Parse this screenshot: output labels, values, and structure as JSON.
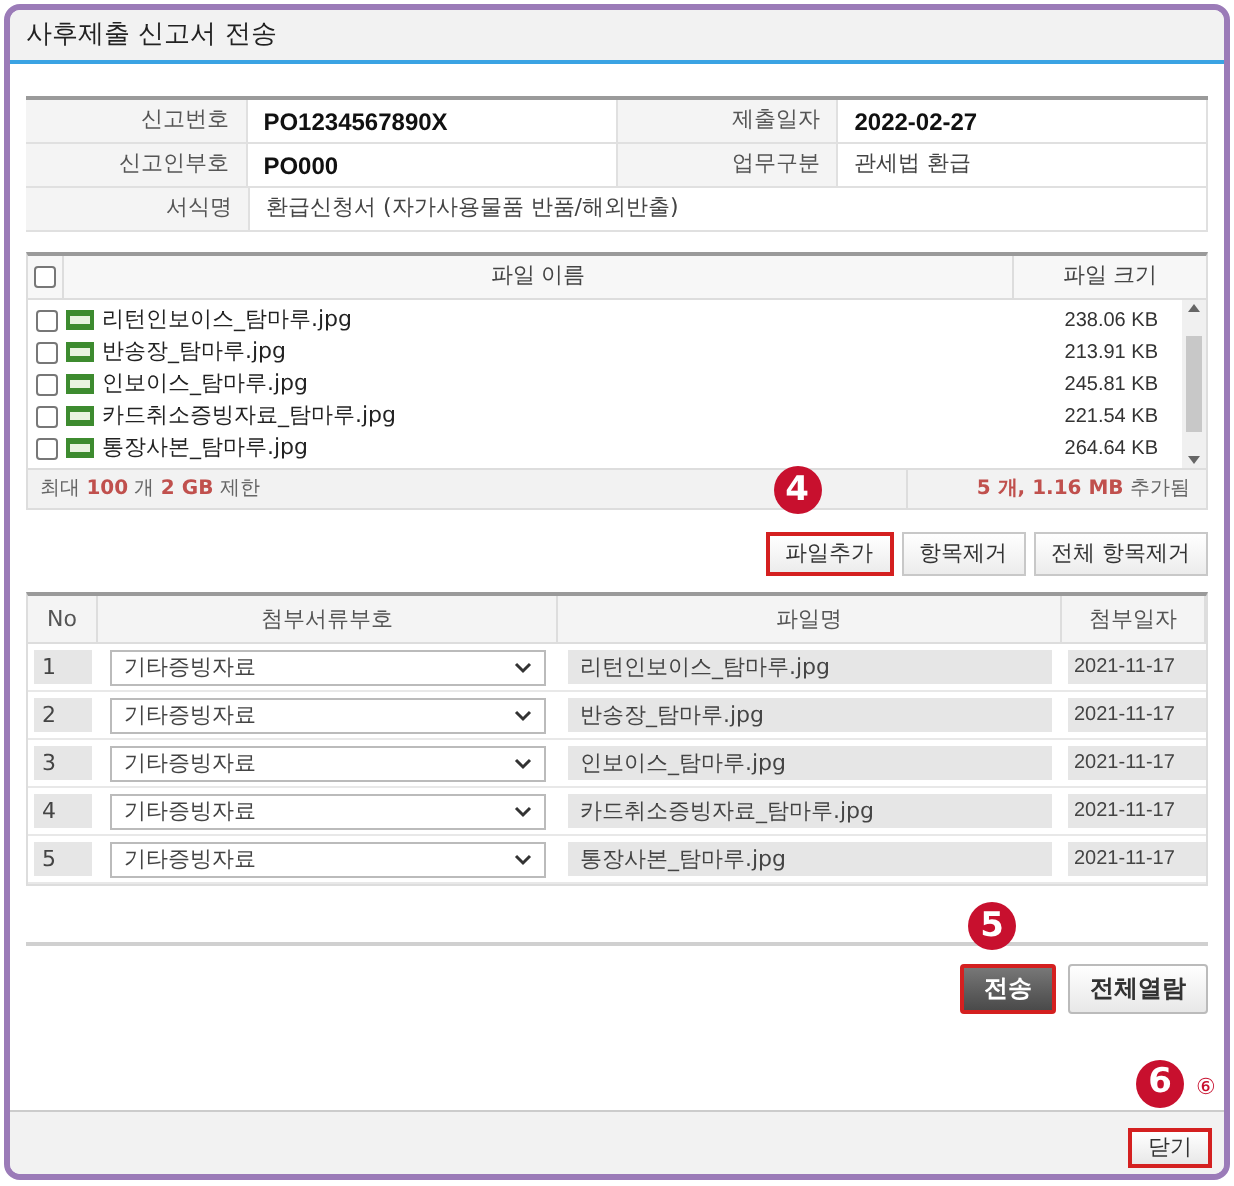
{
  "window": {
    "title": "사후제출 신고서 전송"
  },
  "info_rows": [
    [
      {
        "label": "신고번호",
        "value": "PO1234567890X",
        "kind": "code"
      },
      {
        "label": "제출일자",
        "value": "2022-02-27",
        "kind": "code"
      }
    ],
    [
      {
        "label": "신고인부호",
        "value": "PO000",
        "kind": "code"
      },
      {
        "label": "업무구분",
        "value": "관세법 환급",
        "kind": "text"
      }
    ],
    [
      {
        "label": "서식명",
        "value": "환급신청서 (자가사용물품 반품/해외반출)",
        "kind": "text"
      }
    ]
  ],
  "file_list": {
    "select_all_checked": false,
    "columns": [
      "파일 이름",
      "파일 크기"
    ],
    "files": [
      {
        "name": "리턴인보이스_탐마루.jpg",
        "size": "238.06 KB",
        "checked": false
      },
      {
        "name": "반송장_탐마루.jpg",
        "size": "213.91 KB",
        "checked": false
      },
      {
        "name": "인보이스_탐마루.jpg",
        "size": "245.81 KB",
        "checked": false
      },
      {
        "name": "카드취소증빙자료_탐마루.jpg",
        "size": "221.54 KB",
        "checked": false
      },
      {
        "name": "통장사본_탐마루.jpg",
        "size": "264.64 KB",
        "checked": false
      }
    ],
    "limit": "최대 **100** 개 **2 GB** 제한",
    "summary": "**5 개, 1.16 MB** 추가됨"
  },
  "file_buttons": [
    {
      "label": "파일추가",
      "highlighted": true,
      "marker": "4"
    },
    {
      "label": "항목제거",
      "highlighted": false
    },
    {
      "label": "전체 항목제거",
      "highlighted": false
    }
  ],
  "attach_table": {
    "columns": [
      "No",
      "첨부서류부호",
      "파일명",
      "첨부일자"
    ],
    "rows": [
      {
        "no": "1",
        "doc_type": "기타증빙자료",
        "file_name": "리턴인보이스_탐마루.jpg",
        "date": "2021-11-17"
      },
      {
        "no": "2",
        "doc_type": "기타증빙자료",
        "file_name": "반송장_탐마루.jpg",
        "date": "2021-11-17"
      },
      {
        "no": "3",
        "doc_type": "기타증빙자료",
        "file_name": "인보이스_탐마루.jpg",
        "date": "2021-11-17"
      },
      {
        "no": "4",
        "doc_type": "기타증빙자료",
        "file_name": "카드취소증빙자료_탐마루.jpg",
        "date": "2021-11-17"
      },
      {
        "no": "5",
        "doc_type": "기타증빙자료",
        "file_name": "통장사본_탐마루.jpg",
        "date": "2021-11-17"
      }
    ]
  },
  "action_buttons": [
    {
      "label": "전송",
      "kind": "primary",
      "highlighted": true,
      "marker": "5"
    },
    {
      "label": "전체열람",
      "kind": "secondary",
      "highlighted": false
    }
  ],
  "footer": {
    "close_button": {
      "label": "닫기",
      "highlighted": true,
      "marker": "6",
      "note": "⑥"
    }
  }
}
